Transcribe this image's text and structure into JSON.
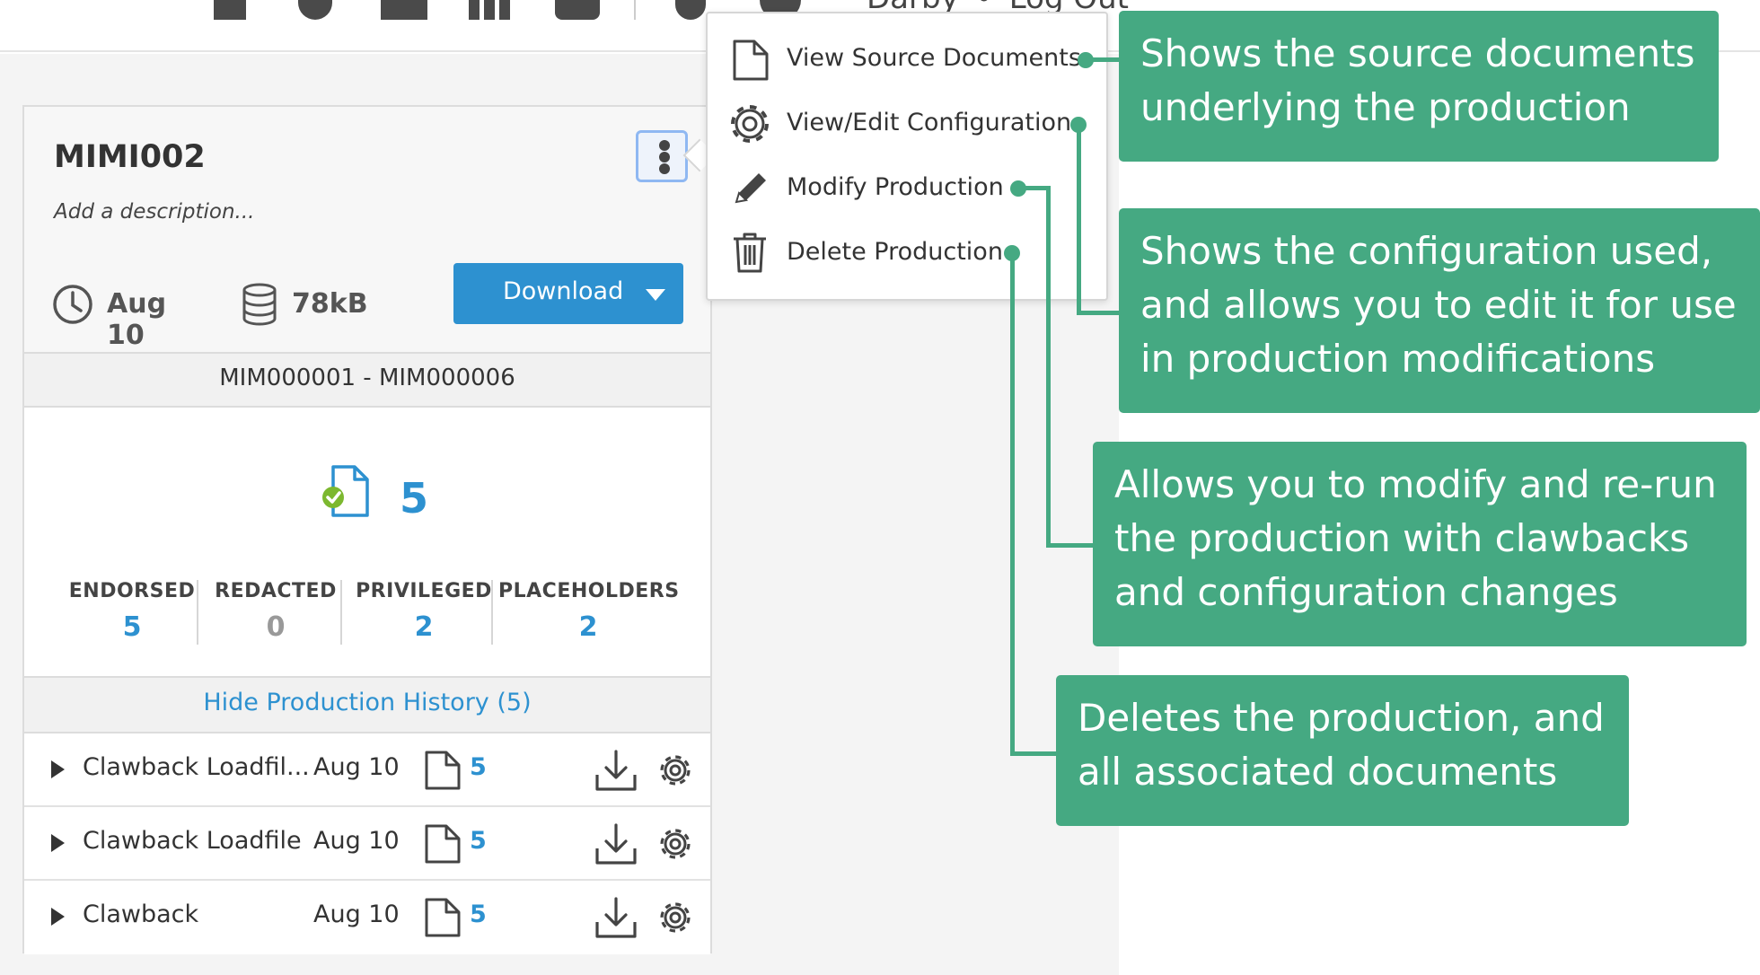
{
  "nav": {
    "user_name": "Darby",
    "separator": "•",
    "logout": "Log Out"
  },
  "production": {
    "title": "MIMI002",
    "description_placeholder": "Add a description...",
    "date": "Aug 10",
    "size": "78kB",
    "download_label": "Download",
    "bates_range": "MIM000001 - MIM000006",
    "document_count": "5",
    "stats": [
      {
        "label": "ENDORSED",
        "value": "5"
      },
      {
        "label": "REDACTED",
        "value": "0"
      },
      {
        "label": "PRIVILEGED",
        "value": "2"
      },
      {
        "label": "PLACEHOLDERS",
        "value": "2"
      }
    ],
    "history_toggle": "Hide Production History (5)",
    "history": [
      {
        "name": "Clawback Loadfil...",
        "date": "Aug 10",
        "count": "5"
      },
      {
        "name": "Clawback Loadfile",
        "date": "Aug 10",
        "count": "5"
      },
      {
        "name": "Clawback",
        "date": "Aug 10",
        "count": "5"
      }
    ]
  },
  "menu": {
    "items": [
      {
        "label": "View Source Documents",
        "icon": "document-icon"
      },
      {
        "label": "View/Edit Configuration",
        "icon": "gear-icon"
      },
      {
        "label": "Modify Production",
        "icon": "pencil-icon"
      },
      {
        "label": "Delete Production",
        "icon": "trash-icon"
      }
    ]
  },
  "callouts": {
    "view_source": "Shows the source documents underlying the production",
    "view_edit_config": "Shows the configuration used, and allows you to edit it for use in production modifications",
    "modify": "Allows you to modify and re-run the production with clawbacks and configuration changes",
    "delete": "Deletes the production, and all associated documents"
  },
  "colors": {
    "accent_blue": "#2d91d0",
    "callout_green": "#45a982",
    "check_green": "#7cb82f"
  }
}
